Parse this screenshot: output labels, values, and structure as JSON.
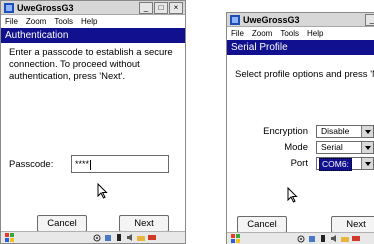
{
  "screen1": {
    "app_title": "UweGrossG3",
    "window_buttons": [
      "_",
      "□",
      "×"
    ],
    "menu": [
      "File",
      "Zoom",
      "Tools",
      "Help"
    ],
    "header": "Authentication",
    "description": "Enter a passcode to establish a secure connection. To proceed without authentication, press 'Next'.",
    "passcode_label": "Passcode:",
    "passcode_value": "****",
    "cancel_label": "Cancel",
    "next_label": "Next"
  },
  "screen2": {
    "app_title": "UweGrossG3",
    "window_buttons": [
      "_",
      "□"
    ],
    "menu": [
      "File",
      "Zoom",
      "Tools",
      "Help"
    ],
    "header": "Serial Profile",
    "description": "Select profile options and press 'Next'.",
    "encryption_label": "Encryption",
    "encryption_value": "Disable",
    "mode_label": "Mode",
    "mode_value": "Serial",
    "port_label": "Port",
    "port_value": "COM6:",
    "cancel_label": "Cancel",
    "next_label": "Next"
  },
  "colors": {
    "header_bg": "#11118f",
    "header_text": "#ffffff",
    "titlebar_bg": "#d7d7d7"
  },
  "icons": [
    "windows-logo-icon",
    "wifi-icon",
    "signal-icon",
    "battery-icon",
    "speaker-icon",
    "folder-icon",
    "keyboard-icon",
    "arrow-cursor-icon"
  ]
}
